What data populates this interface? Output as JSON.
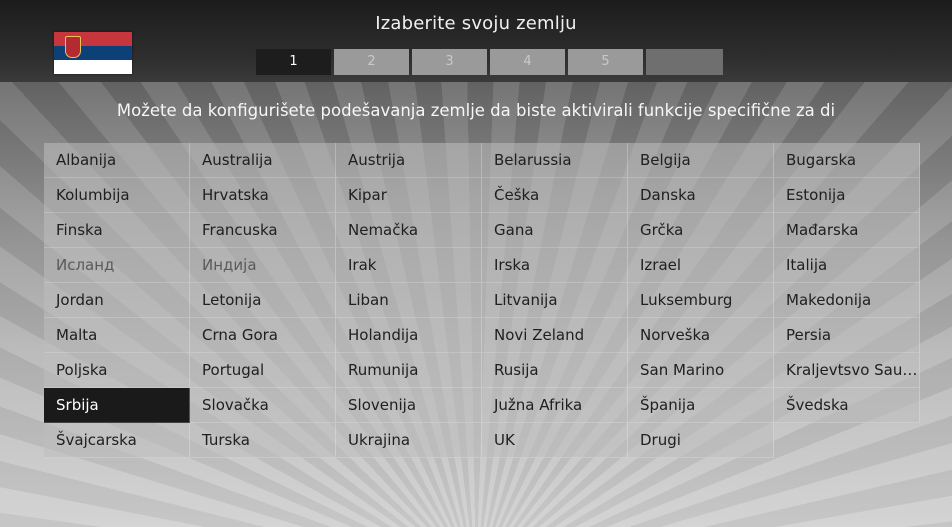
{
  "header": {
    "title": "Izaberite svoju zemlju",
    "flag_icon": "serbia-flag-icon",
    "steps": [
      "1",
      "2",
      "3",
      "4",
      "5"
    ],
    "active_step": "1"
  },
  "subtitle": "Možete da konfigurišete podešavanja zemlje da biste aktivirali funkcije specifične za di",
  "countries": [
    [
      "Albanija",
      "Australija",
      "Austrija",
      "Belarussia",
      "Belgija",
      "Bugarska"
    ],
    [
      "Kolumbija",
      "Hrvatska",
      "Kipar",
      "Češka",
      "Danska",
      "Estonija"
    ],
    [
      "Finska",
      "Francuska",
      "Nemačka",
      "Gana",
      "Grčka",
      "Mađarska"
    ],
    [
      "Исланд",
      "Индија",
      "Irak",
      "Irska",
      "Izrael",
      "Italija"
    ],
    [
      "Jordan",
      "Letonija",
      "Liban",
      "Litvanija",
      "Luksemburg",
      "Makedonija"
    ],
    [
      "Malta",
      "Crna Gora",
      "Holandija",
      "Novi Zeland",
      "Norveška",
      "Persia"
    ],
    [
      "Poljska",
      "Portugal",
      "Rumunija",
      "Rusija",
      "San Marino",
      "Kraljevtsvo Saud..."
    ],
    [
      "Srbija",
      "Slovačka",
      "Slovenija",
      "Južna Afrika",
      "Španija",
      "Švedska"
    ],
    [
      "Švajcarska",
      "Turska",
      "Ukrajina",
      "UK",
      "Drugi",
      ""
    ]
  ],
  "selected_country": "Srbija",
  "colors": {
    "selected_bg": "#1a1a1a",
    "active_step_bg": "#1d1d1d",
    "serbia_red": "#c6363c",
    "serbia_blue": "#0c4076"
  }
}
